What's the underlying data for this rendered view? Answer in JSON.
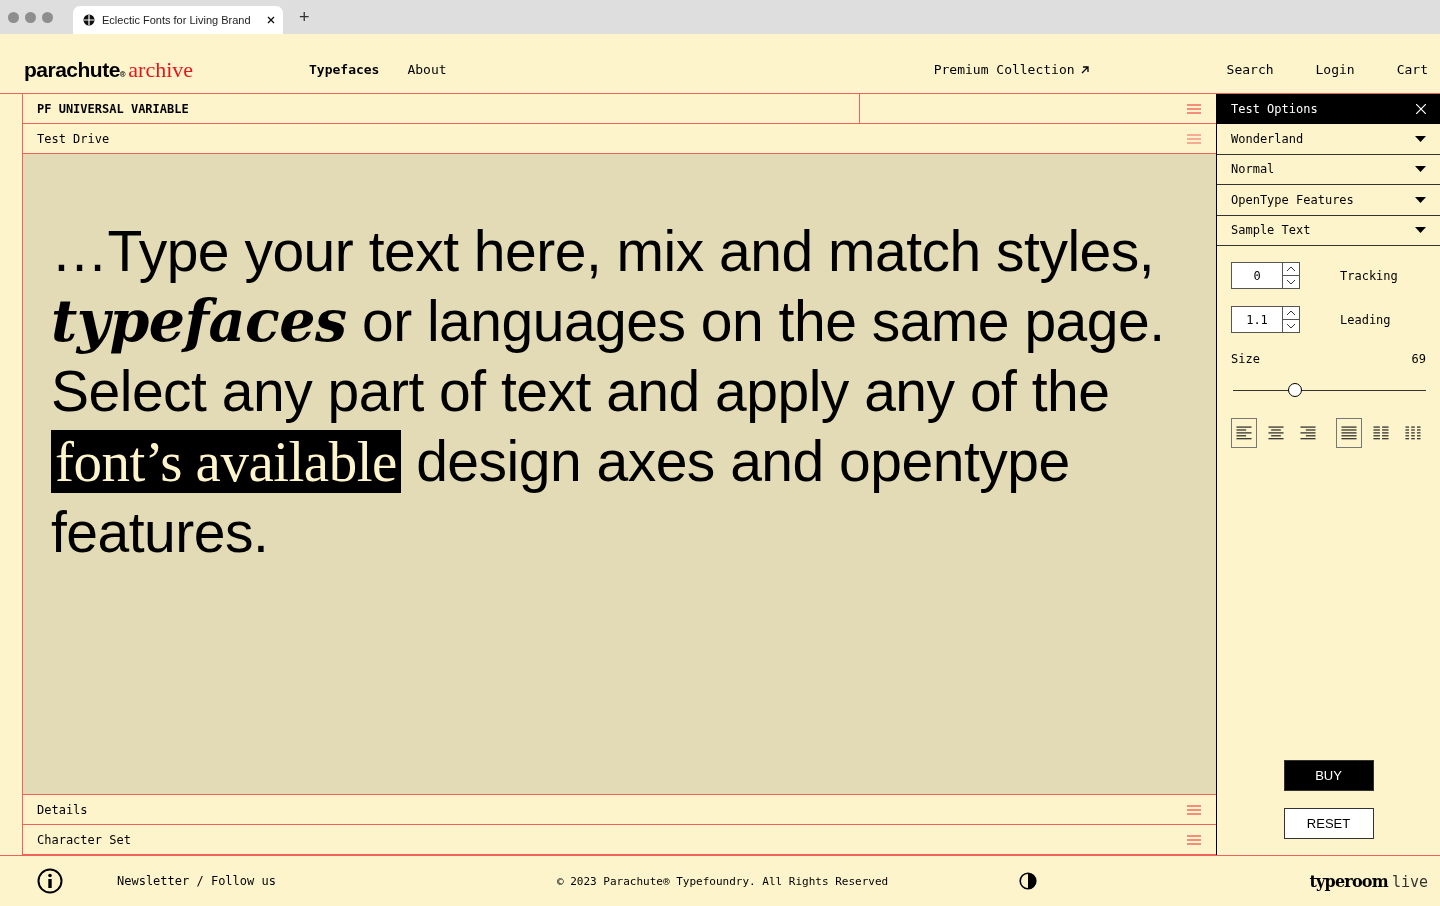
{
  "browser": {
    "tab_title": "Eclectic Fonts for Living Brand",
    "new_tab": "+"
  },
  "header": {
    "logo": "parachute",
    "logo_mark": "®",
    "logo_sub": "archive",
    "nav": [
      {
        "label": "Typefaces",
        "selected": true
      },
      {
        "label": "About",
        "selected": false
      }
    ],
    "premium": "Premium Collection",
    "links": [
      "Search",
      "Login",
      "Cart"
    ]
  },
  "font_title": "PF UNIVERSAL VARIABLE",
  "sections_top": [
    "Test Drive"
  ],
  "sample": [
    {
      "kind": "plain",
      "text": "…Type your text here, mix and match styles, "
    },
    {
      "kind": "bold",
      "text": "typefaces"
    },
    {
      "kind": "plain",
      "text": " or languages on the same page. Select any part of text and apply any of the "
    },
    {
      "kind": "highlight",
      "text": "font’s available"
    },
    {
      "kind": "plain",
      "text": " design axes and opentype features."
    }
  ],
  "sections_bottom": [
    "Details",
    "Character Set"
  ],
  "options": {
    "title": "Test Options",
    "dropdowns": [
      "Wonderland",
      "Normal",
      "OpenType Features",
      "Sample Text"
    ],
    "steppers": [
      {
        "value": "0",
        "label": "Tracking"
      },
      {
        "value": "1.1",
        "label": "Leading"
      }
    ],
    "size": {
      "label": "Size",
      "reading": "69",
      "level": 0.32
    },
    "align": [
      {
        "kind": "left",
        "selected": true
      },
      {
        "kind": "center",
        "selected": false
      },
      {
        "kind": "right",
        "selected": false
      }
    ],
    "columns": [
      {
        "kind": "one",
        "selected": true
      },
      {
        "kind": "two",
        "selected": false
      },
      {
        "kind": "three",
        "selected": false
      }
    ],
    "buy": "BUY",
    "reset": "RESET"
  },
  "footer": {
    "links": "Newsletter / Follow us",
    "copyright": "© 2023 Parachute® Typefoundry. All Rights Reserved",
    "brand": "typeroom",
    "brand_sub": "live"
  }
}
